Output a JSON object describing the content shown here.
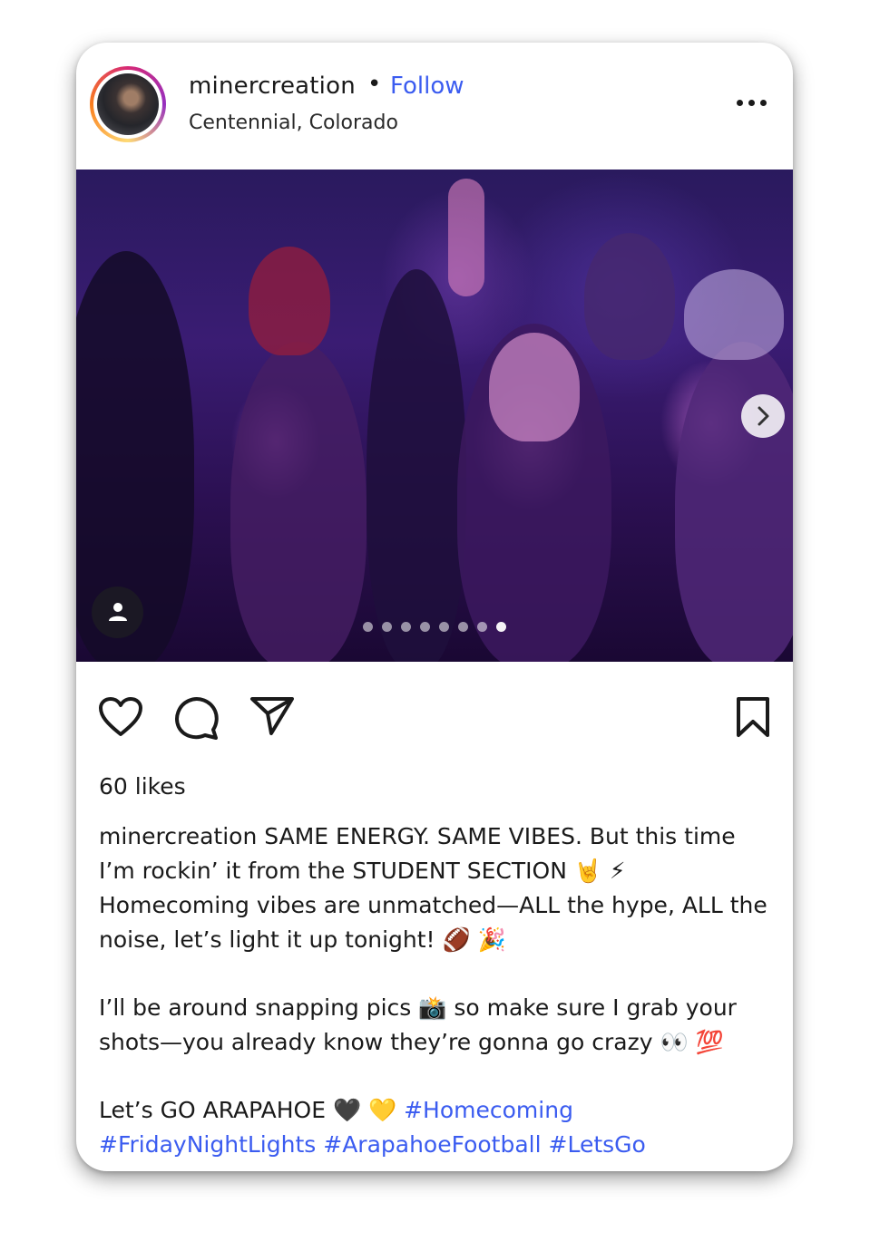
{
  "post": {
    "username": "minercreation",
    "separator": "•",
    "follow_label": "Follow",
    "location": "Centennial, Colorado",
    "likes": "60 likes",
    "carousel": {
      "total_slides": 8,
      "active_slide": 8
    },
    "caption": {
      "username": "minercreation",
      "line1": " SAME ENERGY. SAME VIBES. But this time I’m rockin’ it from the STUDENT SECTION 🤘 ⚡ Homecoming vibes are unmatched—ALL the hype, ALL the noise, let’s light it up tonight! 🏈 🎉",
      "line2": "I’ll be around snapping pics 📸 so make sure I grab your shots—you already know they’re gonna go crazy 👀 💯",
      "line3_text": "Let’s GO ARAPAHOE 🖤 💛 ",
      "hashtags": [
        "#Homecoming",
        "#FridayNightLights",
        "#ArapahoeFootball",
        "#LetsGo"
      ]
    }
  },
  "icons": {
    "more": "more-options-icon",
    "next": "chevron-right-icon",
    "tag": "user-tag-icon",
    "like": "heart-icon",
    "comment": "comment-icon",
    "share": "send-icon",
    "save": "bookmark-icon"
  },
  "colors": {
    "link_blue": "#3b5cf0",
    "text": "#1a1a1a",
    "photo_tint": "#3a1c73"
  }
}
